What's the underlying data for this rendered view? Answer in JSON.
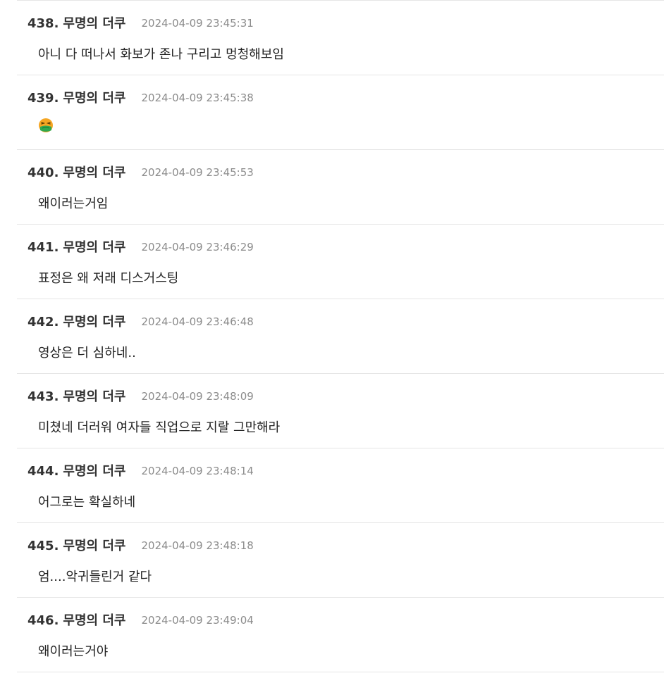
{
  "comments": [
    {
      "number": "438.",
      "author": "무명의 더쿠",
      "timestamp": "2024-04-09 23:45:31",
      "text": "아니 다 떠나서 화보가 존나 구리고 멍청해보임"
    },
    {
      "number": "439.",
      "author": "무명의 더쿠",
      "timestamp": "2024-04-09 23:45:38",
      "text": "",
      "emoji": "nauseated-face-icon"
    },
    {
      "number": "440.",
      "author": "무명의 더쿠",
      "timestamp": "2024-04-09 23:45:53",
      "text": "왜이러는거임"
    },
    {
      "number": "441.",
      "author": "무명의 더쿠",
      "timestamp": "2024-04-09 23:46:29",
      "text": "표정은 왜 저래 디스거스팅"
    },
    {
      "number": "442.",
      "author": "무명의 더쿠",
      "timestamp": "2024-04-09 23:46:48",
      "text": "영상은 더 심하네.."
    },
    {
      "number": "443.",
      "author": "무명의 더쿠",
      "timestamp": "2024-04-09 23:48:09",
      "text": "미쳤네 더러워 여자들 직업으로 지랄 그만해라"
    },
    {
      "number": "444.",
      "author": "무명의 더쿠",
      "timestamp": "2024-04-09 23:48:14",
      "text": "어그로는 확실하네"
    },
    {
      "number": "445.",
      "author": "무명의 더쿠",
      "timestamp": "2024-04-09 23:48:18",
      "text": "엄....악귀들린거 같다"
    },
    {
      "number": "446.",
      "author": "무명의 더쿠",
      "timestamp": "2024-04-09 23:49:04",
      "text": "왜이러는거야"
    }
  ],
  "colors": {
    "author": "#333333",
    "timestamp": "#8c8c8c",
    "body": "#222222",
    "divider": "#e6e6e6"
  }
}
